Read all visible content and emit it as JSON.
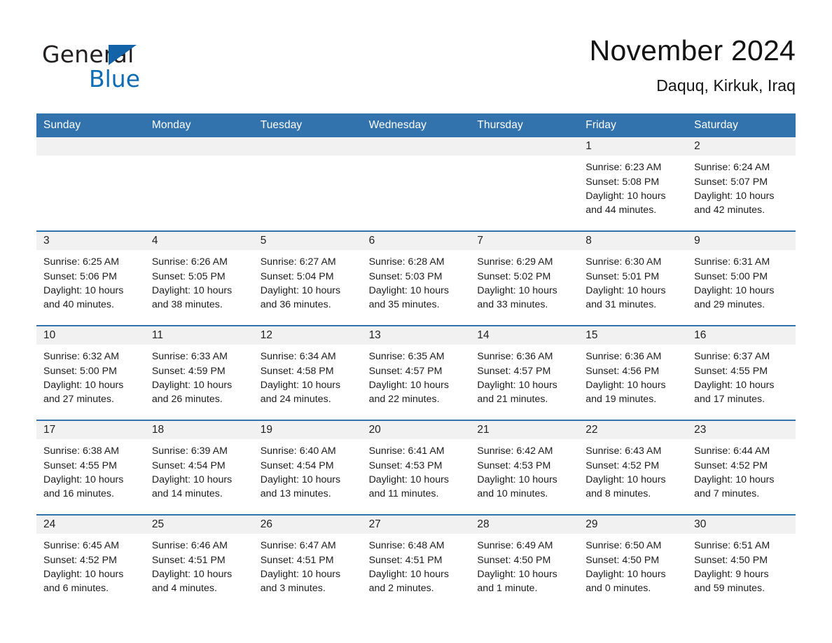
{
  "brand": {
    "name_part1": "General",
    "name_part2": "Blue",
    "triangle_color": "#1263a8",
    "blue_color": "#0d6cb4"
  },
  "header": {
    "month_title": "November 2024",
    "location": "Daquq, Kirkuk, Iraq"
  },
  "theme": {
    "header_blue": "#3273ad",
    "day_band_gray": "#f1f1f1"
  },
  "weekdays": [
    "Sunday",
    "Monday",
    "Tuesday",
    "Wednesday",
    "Thursday",
    "Friday",
    "Saturday"
  ],
  "weeks": [
    [
      {
        "empty": true,
        "number": ""
      },
      {
        "empty": true,
        "number": ""
      },
      {
        "empty": true,
        "number": ""
      },
      {
        "empty": true,
        "number": ""
      },
      {
        "empty": true,
        "number": ""
      },
      {
        "empty": false,
        "number": "1",
        "sunrise": "Sunrise: 6:23 AM",
        "sunset": "Sunset: 5:08 PM",
        "daylight_line1": "Daylight: 10 hours",
        "daylight_line2": "and 44 minutes."
      },
      {
        "empty": false,
        "number": "2",
        "sunrise": "Sunrise: 6:24 AM",
        "sunset": "Sunset: 5:07 PM",
        "daylight_line1": "Daylight: 10 hours",
        "daylight_line2": "and 42 minutes."
      }
    ],
    [
      {
        "empty": false,
        "number": "3",
        "sunrise": "Sunrise: 6:25 AM",
        "sunset": "Sunset: 5:06 PM",
        "daylight_line1": "Daylight: 10 hours",
        "daylight_line2": "and 40 minutes."
      },
      {
        "empty": false,
        "number": "4",
        "sunrise": "Sunrise: 6:26 AM",
        "sunset": "Sunset: 5:05 PM",
        "daylight_line1": "Daylight: 10 hours",
        "daylight_line2": "and 38 minutes."
      },
      {
        "empty": false,
        "number": "5",
        "sunrise": "Sunrise: 6:27 AM",
        "sunset": "Sunset: 5:04 PM",
        "daylight_line1": "Daylight: 10 hours",
        "daylight_line2": "and 36 minutes."
      },
      {
        "empty": false,
        "number": "6",
        "sunrise": "Sunrise: 6:28 AM",
        "sunset": "Sunset: 5:03 PM",
        "daylight_line1": "Daylight: 10 hours",
        "daylight_line2": "and 35 minutes."
      },
      {
        "empty": false,
        "number": "7",
        "sunrise": "Sunrise: 6:29 AM",
        "sunset": "Sunset: 5:02 PM",
        "daylight_line1": "Daylight: 10 hours",
        "daylight_line2": "and 33 minutes."
      },
      {
        "empty": false,
        "number": "8",
        "sunrise": "Sunrise: 6:30 AM",
        "sunset": "Sunset: 5:01 PM",
        "daylight_line1": "Daylight: 10 hours",
        "daylight_line2": "and 31 minutes."
      },
      {
        "empty": false,
        "number": "9",
        "sunrise": "Sunrise: 6:31 AM",
        "sunset": "Sunset: 5:00 PM",
        "daylight_line1": "Daylight: 10 hours",
        "daylight_line2": "and 29 minutes."
      }
    ],
    [
      {
        "empty": false,
        "number": "10",
        "sunrise": "Sunrise: 6:32 AM",
        "sunset": "Sunset: 5:00 PM",
        "daylight_line1": "Daylight: 10 hours",
        "daylight_line2": "and 27 minutes."
      },
      {
        "empty": false,
        "number": "11",
        "sunrise": "Sunrise: 6:33 AM",
        "sunset": "Sunset: 4:59 PM",
        "daylight_line1": "Daylight: 10 hours",
        "daylight_line2": "and 26 minutes."
      },
      {
        "empty": false,
        "number": "12",
        "sunrise": "Sunrise: 6:34 AM",
        "sunset": "Sunset: 4:58 PM",
        "daylight_line1": "Daylight: 10 hours",
        "daylight_line2": "and 24 minutes."
      },
      {
        "empty": false,
        "number": "13",
        "sunrise": "Sunrise: 6:35 AM",
        "sunset": "Sunset: 4:57 PM",
        "daylight_line1": "Daylight: 10 hours",
        "daylight_line2": "and 22 minutes."
      },
      {
        "empty": false,
        "number": "14",
        "sunrise": "Sunrise: 6:36 AM",
        "sunset": "Sunset: 4:57 PM",
        "daylight_line1": "Daylight: 10 hours",
        "daylight_line2": "and 21 minutes."
      },
      {
        "empty": false,
        "number": "15",
        "sunrise": "Sunrise: 6:36 AM",
        "sunset": "Sunset: 4:56 PM",
        "daylight_line1": "Daylight: 10 hours",
        "daylight_line2": "and 19 minutes."
      },
      {
        "empty": false,
        "number": "16",
        "sunrise": "Sunrise: 6:37 AM",
        "sunset": "Sunset: 4:55 PM",
        "daylight_line1": "Daylight: 10 hours",
        "daylight_line2": "and 17 minutes."
      }
    ],
    [
      {
        "empty": false,
        "number": "17",
        "sunrise": "Sunrise: 6:38 AM",
        "sunset": "Sunset: 4:55 PM",
        "daylight_line1": "Daylight: 10 hours",
        "daylight_line2": "and 16 minutes."
      },
      {
        "empty": false,
        "number": "18",
        "sunrise": "Sunrise: 6:39 AM",
        "sunset": "Sunset: 4:54 PM",
        "daylight_line1": "Daylight: 10 hours",
        "daylight_line2": "and 14 minutes."
      },
      {
        "empty": false,
        "number": "19",
        "sunrise": "Sunrise: 6:40 AM",
        "sunset": "Sunset: 4:54 PM",
        "daylight_line1": "Daylight: 10 hours",
        "daylight_line2": "and 13 minutes."
      },
      {
        "empty": false,
        "number": "20",
        "sunrise": "Sunrise: 6:41 AM",
        "sunset": "Sunset: 4:53 PM",
        "daylight_line1": "Daylight: 10 hours",
        "daylight_line2": "and 11 minutes."
      },
      {
        "empty": false,
        "number": "21",
        "sunrise": "Sunrise: 6:42 AM",
        "sunset": "Sunset: 4:53 PM",
        "daylight_line1": "Daylight: 10 hours",
        "daylight_line2": "and 10 minutes."
      },
      {
        "empty": false,
        "number": "22",
        "sunrise": "Sunrise: 6:43 AM",
        "sunset": "Sunset: 4:52 PM",
        "daylight_line1": "Daylight: 10 hours",
        "daylight_line2": "and 8 minutes."
      },
      {
        "empty": false,
        "number": "23",
        "sunrise": "Sunrise: 6:44 AM",
        "sunset": "Sunset: 4:52 PM",
        "daylight_line1": "Daylight: 10 hours",
        "daylight_line2": "and 7 minutes."
      }
    ],
    [
      {
        "empty": false,
        "number": "24",
        "sunrise": "Sunrise: 6:45 AM",
        "sunset": "Sunset: 4:52 PM",
        "daylight_line1": "Daylight: 10 hours",
        "daylight_line2": "and 6 minutes."
      },
      {
        "empty": false,
        "number": "25",
        "sunrise": "Sunrise: 6:46 AM",
        "sunset": "Sunset: 4:51 PM",
        "daylight_line1": "Daylight: 10 hours",
        "daylight_line2": "and 4 minutes."
      },
      {
        "empty": false,
        "number": "26",
        "sunrise": "Sunrise: 6:47 AM",
        "sunset": "Sunset: 4:51 PM",
        "daylight_line1": "Daylight: 10 hours",
        "daylight_line2": "and 3 minutes."
      },
      {
        "empty": false,
        "number": "27",
        "sunrise": "Sunrise: 6:48 AM",
        "sunset": "Sunset: 4:51 PM",
        "daylight_line1": "Daylight: 10 hours",
        "daylight_line2": "and 2 minutes."
      },
      {
        "empty": false,
        "number": "28",
        "sunrise": "Sunrise: 6:49 AM",
        "sunset": "Sunset: 4:50 PM",
        "daylight_line1": "Daylight: 10 hours",
        "daylight_line2": "and 1 minute."
      },
      {
        "empty": false,
        "number": "29",
        "sunrise": "Sunrise: 6:50 AM",
        "sunset": "Sunset: 4:50 PM",
        "daylight_line1": "Daylight: 10 hours",
        "daylight_line2": "and 0 minutes."
      },
      {
        "empty": false,
        "number": "30",
        "sunrise": "Sunrise: 6:51 AM",
        "sunset": "Sunset: 4:50 PM",
        "daylight_line1": "Daylight: 9 hours",
        "daylight_line2": "and 59 minutes."
      }
    ]
  ]
}
